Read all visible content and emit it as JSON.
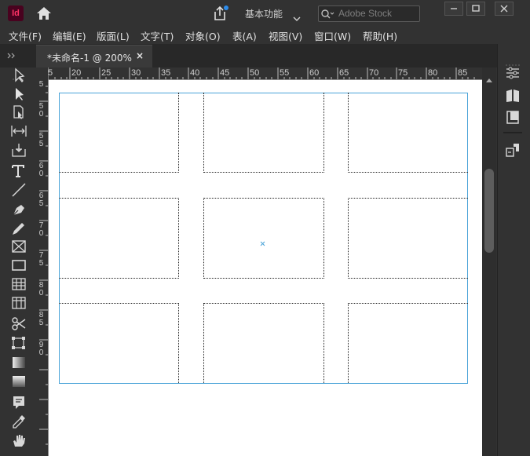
{
  "app": {
    "logo_text": "Id",
    "brand_color": "#49021f",
    "logo_color": "#ff3366"
  },
  "titlebar": {
    "workspace_label": "基本功能",
    "search_placeholder": "Adobe Stock"
  },
  "menu": [
    "文件(F)",
    "编辑(E)",
    "版面(L)",
    "文字(T)",
    "对象(O)",
    "表(A)",
    "视图(V)",
    "窗口(W)",
    "帮助(H)"
  ],
  "document_tab": {
    "label": "*未命名-1 @ 200%",
    "close_glyph": "×"
  },
  "ruler": {
    "horizontal": [
      "5",
      "20",
      "25",
      "30",
      "35",
      "40",
      "45",
      "50",
      "55",
      "60",
      "65",
      "70",
      "75",
      "80",
      "85"
    ],
    "vertical": [
      "5",
      "5 0",
      "5 5",
      "6 0",
      "6 5",
      "7 0",
      "7 5",
      "8 0",
      "8 5",
      "9 0"
    ]
  },
  "tools": [
    "selection-tool-icon",
    "direct-selection-tool-icon",
    "page-tool-icon",
    "gap-tool-icon",
    "content-collector-icon",
    "type-tool-icon",
    "line-tool-icon",
    "pen-tool-icon",
    "pencil-tool-icon",
    "rectangle-frame-tool-icon",
    "rectangle-tool-icon",
    "table-tool-icon",
    "grid-tool-icon",
    "scissors-tool-icon",
    "free-transform-tool-icon",
    "gradient-swatch-tool-icon",
    "gradient-feather-tool-icon",
    "note-tool-icon",
    "eyedropper-tool-icon",
    "hand-tool-icon"
  ],
  "right_panel": [
    "properties-icon",
    "pages-icon",
    "layers-icon",
    "links-icon"
  ],
  "colors": {
    "page_border": "#4aa3d8",
    "canvas": "#ffffff",
    "chrome": "#323232"
  }
}
